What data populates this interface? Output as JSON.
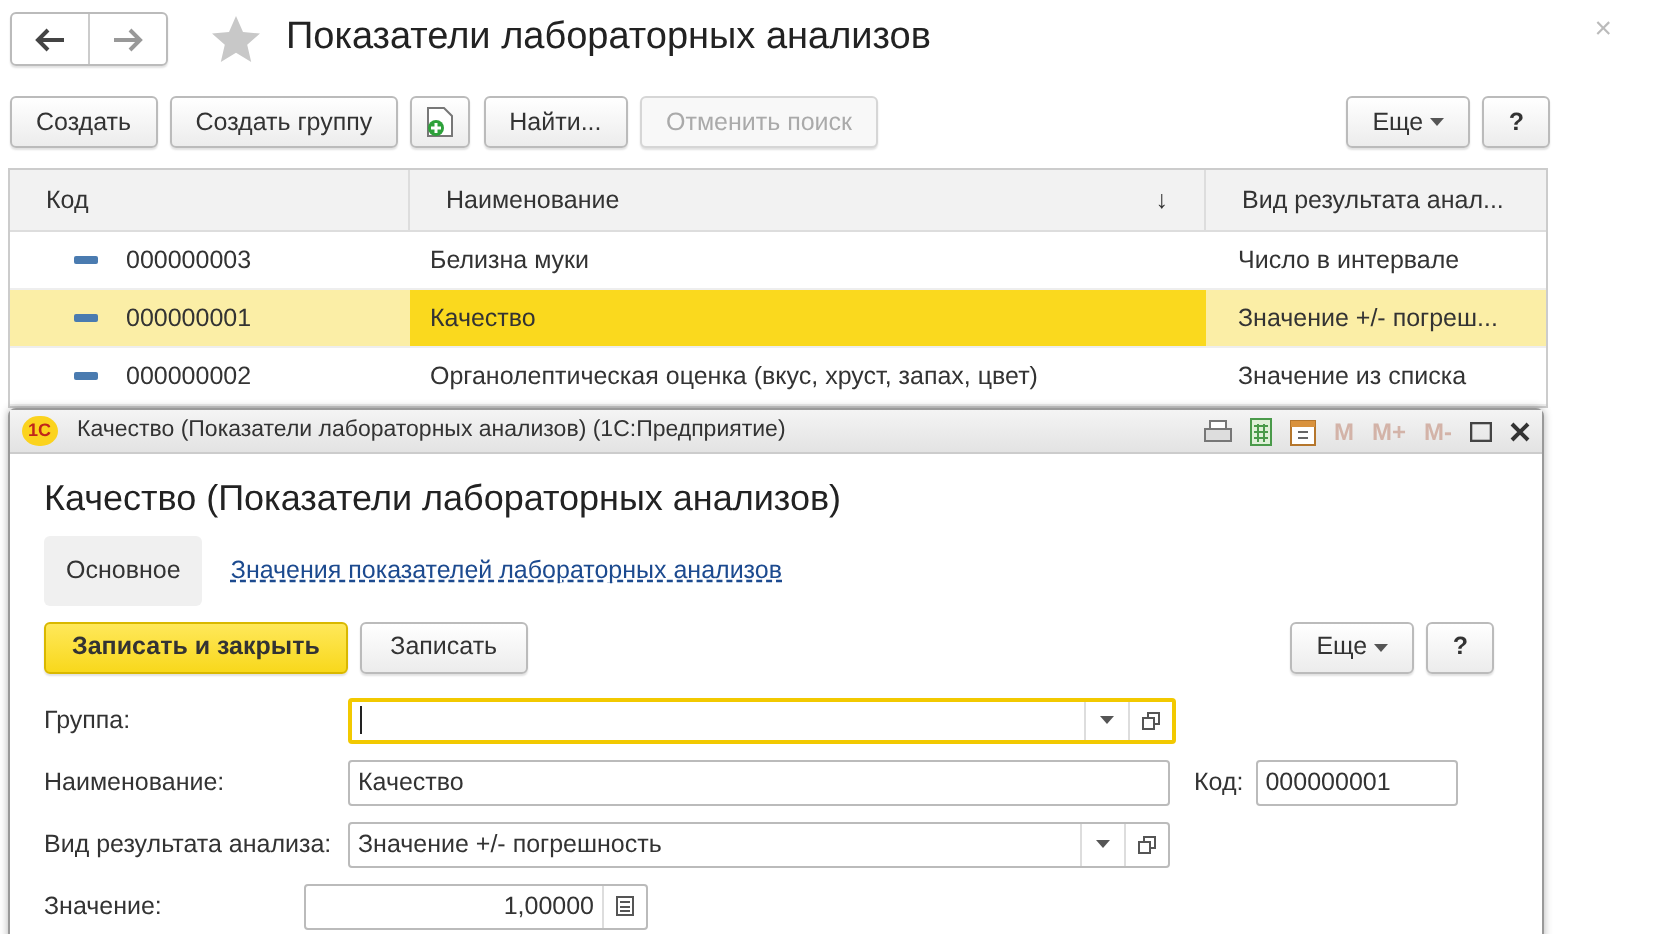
{
  "window": {
    "title": "Показатели лабораторных анализов",
    "close": "×"
  },
  "toolbar": {
    "buttons": [
      {
        "kind": "text",
        "label": "Создать",
        "disabled": false
      },
      {
        "kind": "text",
        "label": "Создать группу",
        "disabled": false
      },
      {
        "kind": "icon",
        "disabled": false
      },
      {
        "kind": "text",
        "label": "Найти...",
        "disabled": false
      },
      {
        "kind": "text",
        "label": "Отменить поиск",
        "disabled": true
      }
    ],
    "more": "Еще",
    "help": "?"
  },
  "table": {
    "columns": [
      {
        "label": "Код"
      },
      {
        "label": "Наименование",
        "sort_mark": "↓"
      },
      {
        "label": "Вид результата анал..."
      }
    ],
    "rows": [
      {
        "code": "000000003",
        "name": "Белизна муки",
        "result": "Число в интервале",
        "selected": false
      },
      {
        "code": "000000001",
        "name": "Качество",
        "result": "Значение +/- погреш...",
        "selected": true
      },
      {
        "code": "000000002",
        "name": "Органолептическая оценка (вкус, хруст, запах, цвет)",
        "result": "Значение из списка",
        "selected": false
      }
    ]
  },
  "dialog": {
    "logo": "1С",
    "title": "Качество (Показатели лабораторных анализов)  (1С:Предприятие)",
    "memory_buttons": [
      "M",
      "M+",
      "M-"
    ],
    "heading": "Качество (Показатели лабораторных анализов)",
    "tabs": [
      {
        "label": "Основное",
        "selected": true
      },
      {
        "label": "Значения показателей лабораторных анализов",
        "selected": false
      }
    ],
    "buttons": [
      {
        "label": "Записать и закрыть",
        "kind": "primary"
      },
      {
        "label": "Записать",
        "kind": "default"
      }
    ],
    "more": "Еще",
    "help": "?",
    "fields": [
      {
        "kind": "select",
        "label": "Группа:",
        "focused": true
      },
      {
        "kind": "text",
        "label": "Наименование:",
        "value": "Качество",
        "extra_label": "Код:",
        "extra_value": "000000001",
        "focused": false
      },
      {
        "kind": "select",
        "label": "Вид результата анализа:",
        "value": "Значение +/- погрешность",
        "focused": false
      },
      {
        "kind": "number",
        "label": "Значение:",
        "value": "1,00000",
        "focused": false
      }
    ]
  }
}
